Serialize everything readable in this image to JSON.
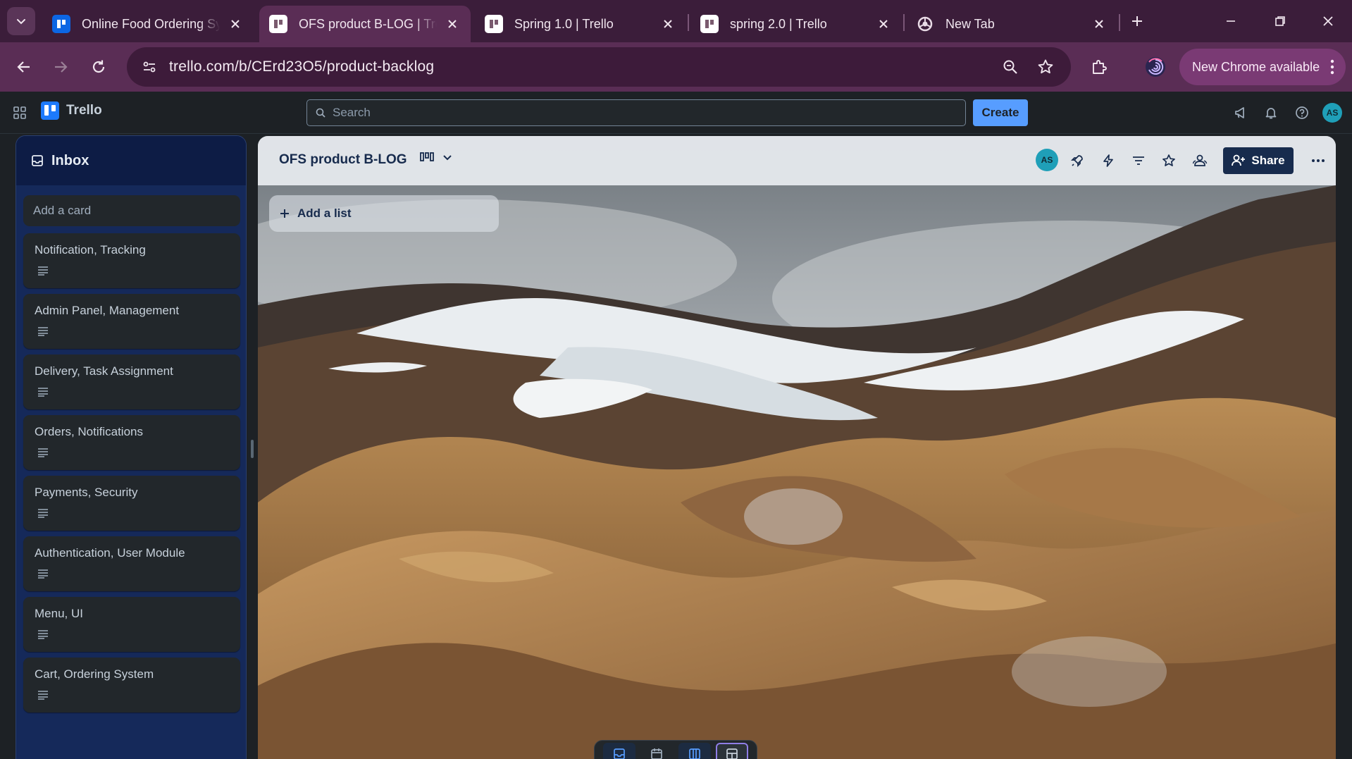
{
  "browser": {
    "tabs": [
      {
        "title": "Online Food Ordering Sy",
        "favicon": "trello-blue-icon",
        "active": false
      },
      {
        "title": "OFS product B-LOG | Trel",
        "favicon": "trello-icon",
        "active": true
      },
      {
        "title": "Spring 1.0 | Trello",
        "favicon": "trello-icon",
        "active": false
      },
      {
        "title": "spring 2.0 | Trello",
        "favicon": "trello-icon",
        "active": false
      },
      {
        "title": "New Tab",
        "favicon": "chrome-icon",
        "active": false
      }
    ],
    "url": "trello.com/b/CErd23O5/product-backlog",
    "update_label": "New Chrome available",
    "theme": {
      "tabbar": "#3b1d3a",
      "toolbar": "#5a2d55"
    }
  },
  "header": {
    "app_name": "Trello",
    "search_placeholder": "Search",
    "create_label": "Create",
    "avatar_initials": "AS",
    "accent": "#579dff"
  },
  "inbox": {
    "title": "Inbox",
    "add_card_placeholder": "Add a card",
    "cards": [
      {
        "title": "Notification, Tracking"
      },
      {
        "title": "Admin Panel, Management"
      },
      {
        "title": "Delivery, Task Assignment"
      },
      {
        "title": "Orders, Notifications"
      },
      {
        "title": "Payments, Security"
      },
      {
        "title": "Authentication, User Module"
      },
      {
        "title": "Menu, UI"
      },
      {
        "title": "Cart, Ordering System"
      }
    ]
  },
  "board": {
    "title": "OFS product B-LOG",
    "member_initials": "AS",
    "share_label": "Share",
    "add_list_label": "Add a list"
  }
}
